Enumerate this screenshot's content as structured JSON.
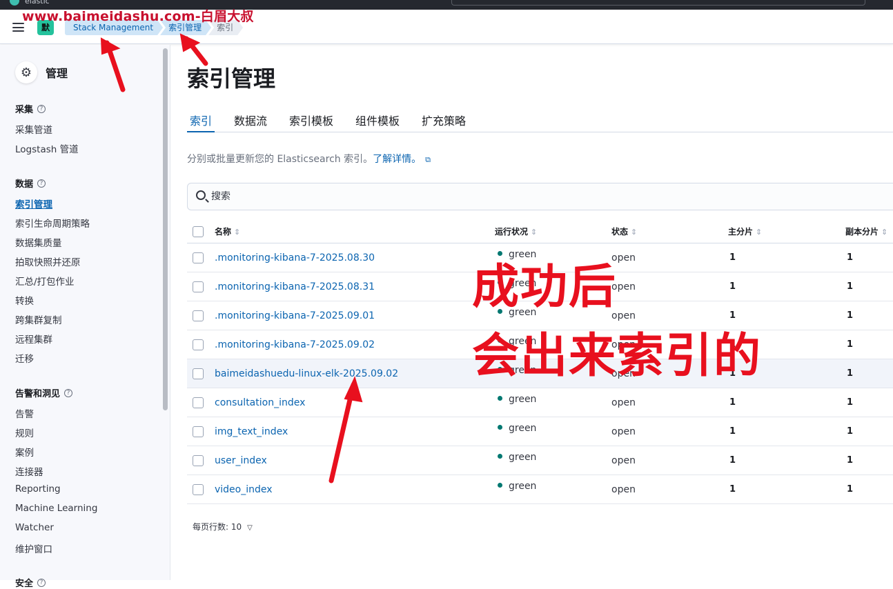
{
  "topbar": {
    "brand": "elastic"
  },
  "watermark": "www.baimeidashu.com-白眉大叔",
  "header": {
    "space_avatar": "默",
    "breadcrumbs": [
      "Stack Management",
      "索引管理",
      "索引"
    ]
  },
  "sidebar": {
    "title": "管理",
    "groups": [
      {
        "label": "采集",
        "items": [
          "采集管道",
          "Logstash 管道"
        ]
      },
      {
        "label": "数据",
        "items": [
          "索引管理",
          "索引生命周期策略",
          "数据集质量",
          "拍取快照并还原",
          "汇总/打包作业",
          "转换",
          "跨集群复制",
          "远程集群",
          "迁移"
        ]
      },
      {
        "label": "告警和洞见",
        "items": [
          "告警",
          "规则",
          "案例",
          "连接器",
          "Reporting",
          "Machine Learning",
          "Watcher",
          "维护窗口"
        ]
      },
      {
        "label": "安全",
        "items": []
      }
    ],
    "active_item": "索引管理"
  },
  "main": {
    "page_title": "索引管理",
    "tabs": [
      "索引",
      "数据流",
      "索引模板",
      "组件模板",
      "扩充策略"
    ],
    "active_tab": "索引",
    "description": "分别或批量更新您的 Elasticsearch 索引。",
    "learn_more": "了解详情。",
    "search": {
      "placeholder": "搜索",
      "value": ""
    },
    "table": {
      "columns": [
        "名称",
        "运行状况",
        "状态",
        "主分片",
        "副本分片"
      ],
      "rows": [
        {
          "name": ".monitoring-kibana-7-2025.08.30",
          "health": "green",
          "status": "open",
          "primaries": "1",
          "replicas": "1"
        },
        {
          "name": ".monitoring-kibana-7-2025.08.31",
          "health": "green",
          "status": "open",
          "primaries": "1",
          "replicas": "1"
        },
        {
          "name": ".monitoring-kibana-7-2025.09.01",
          "health": "green",
          "status": "open",
          "primaries": "1",
          "replicas": "1"
        },
        {
          "name": ".monitoring-kibana-7-2025.09.02",
          "health": "green",
          "status": "open",
          "primaries": "1",
          "replicas": "1"
        },
        {
          "name": "baimeidashuedu-linux-elk-2025.09.02",
          "health": "green",
          "status": "open",
          "primaries": "1",
          "replicas": "1"
        },
        {
          "name": "consultation_index",
          "health": "green",
          "status": "open",
          "primaries": "1",
          "replicas": "1"
        },
        {
          "name": "img_text_index",
          "health": "green",
          "status": "open",
          "primaries": "1",
          "replicas": "1"
        },
        {
          "name": "user_index",
          "health": "green",
          "status": "open",
          "primaries": "1",
          "replicas": "1"
        },
        {
          "name": "video_index",
          "health": "green",
          "status": "open",
          "primaries": "1",
          "replicas": "1"
        }
      ]
    },
    "rows_per_page": "每页行数: 10"
  },
  "annotation": {
    "line1": "成功后",
    "line2": "会出来索引的"
  },
  "colors": {
    "link": "#0b64b0",
    "health_green": "#007871",
    "annotation_red": "#e8101e"
  }
}
